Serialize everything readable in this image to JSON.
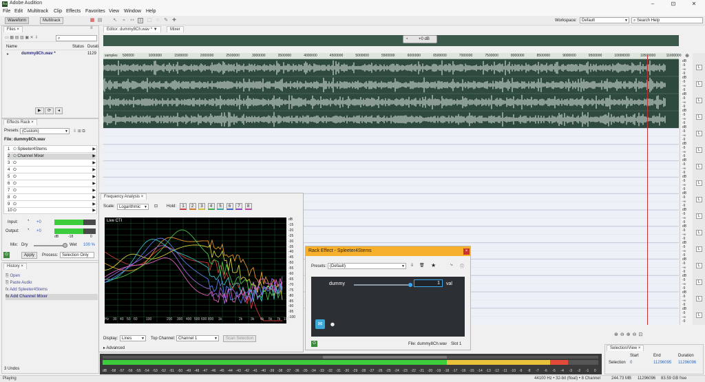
{
  "window": {
    "title": "Adobe Audition",
    "app_badge": "Au",
    "min": "–",
    "max": "⊡",
    "close": "✕"
  },
  "menu": [
    "File",
    "Edit",
    "Multitrack",
    "Clip",
    "Effects",
    "Favorites",
    "View",
    "Window",
    "Help"
  ],
  "toolbar": {
    "waveform_label": "Waveform",
    "multitrack_label": "Multitrack",
    "workspace_label": "Workspace:",
    "workspace_value": "Default",
    "search_placeholder": "Search Help"
  },
  "files_panel": {
    "title": "Files",
    "col_name": "Name",
    "col_status": "Status",
    "col_duration": "Durati",
    "file_name": "dummy8Ch.wav *",
    "file_duration": "1129"
  },
  "effects_rack": {
    "title": "Effects Rack",
    "presets_label": "Presets:",
    "presets_value": "(Custom)",
    "file_label": "File: dummy8Ch.wav",
    "slots": [
      "Spleeter4Stems",
      "Channel Mixer",
      "",
      "",
      "",
      "",
      "",
      "",
      "",
      ""
    ],
    "input_label": "Input:",
    "input_value": "+0",
    "output_label": "Output:",
    "output_value": "+0",
    "meter_marks": [
      "dB",
      "-18",
      "0"
    ],
    "mix_label": "Mix:",
    "dry_label": "Dry",
    "wet_label": "Wet",
    "wet_value": "100 %",
    "apply_label": "Apply",
    "process_label": "Process:",
    "process_value": "Selection Only"
  },
  "history": {
    "title": "History",
    "items": [
      "Open",
      "Paste Audio",
      "Add Spleeter4Stems",
      "Add Channel Mixer"
    ],
    "undo_count": "3 Undos"
  },
  "editor": {
    "tab_label": "Editor: dummy8Ch.wav *",
    "mixer_label": "Mixer",
    "volume_value": "+0 dB",
    "ruler_unit": "samples",
    "ruler_ticks": [
      "500000",
      "1000000",
      "1500000",
      "2000000",
      "2500000",
      "3000000",
      "3500000",
      "4000000",
      "4500000",
      "5000000",
      "5500000",
      "6000000",
      "6500000",
      "7000000",
      "7500000",
      "8000000",
      "8500000",
      "9000000",
      "9500000",
      "10000000",
      "10500000",
      "11000000"
    ],
    "db_label": "dB"
  },
  "freq_analysis": {
    "title": "Frequency Analysis",
    "scale_label": "Scale:",
    "scale_value": "Logarithmic",
    "hold_label": "Hold:",
    "hold_buttons": [
      "1",
      "2",
      "3",
      "4",
      "5",
      "6",
      "7",
      "8"
    ],
    "hold_colors": [
      "#d23b3b",
      "#d27a2a",
      "#d6c43a",
      "#3fae3f",
      "#2ea8a8",
      "#3a5fd2",
      "#8e44c8",
      "#c844a8"
    ],
    "live_label": "Live CTI",
    "db_ticks": [
      "dB",
      "-15",
      "-20",
      "-25",
      "-30",
      "-35",
      "-40",
      "-45",
      "-50",
      "-55",
      "-60",
      "-65",
      "-70",
      "-75",
      "-80",
      "-85",
      "-90",
      "-95",
      "-100"
    ],
    "hz_ticks": [
      "Hz",
      "30",
      "40",
      "50",
      "60",
      "100",
      "200",
      "300",
      "400",
      "500",
      "600",
      "800",
      "1k",
      "2k",
      "3k",
      "4k",
      "5k",
      "7k",
      "10k"
    ],
    "display_label": "Display:",
    "display_value": "Lines",
    "top_channel_label": "Top Channel:",
    "top_channel_value": "Channel 1",
    "scan_label": "Scan Selection",
    "advanced_label": "Advanced"
  },
  "rack_effect": {
    "title": "Rack Effect - Spleeter4Stems",
    "presets_label": "Presets:",
    "presets_value": "(Default)",
    "param_name": "dummy",
    "param_value": "1",
    "param_unit": "val",
    "file_label": "File: dummy8Ch.wav",
    "slot_label": "Slot 1",
    "slider_fraction": 1.0
  },
  "level_meter": {
    "ticks": [
      "dB",
      "-58",
      "-57",
      "-56",
      "-55",
      "-54",
      "-53",
      "-52",
      "-51",
      "-50",
      "-49",
      "-48",
      "-47",
      "-46",
      "-45",
      "-44",
      "-43",
      "-42",
      "-41",
      "-40",
      "-39",
      "-38",
      "-37",
      "-36",
      "-35",
      "-34",
      "-33",
      "-32",
      "-31",
      "-30",
      "-29",
      "-28",
      "-27",
      "-26",
      "-25",
      "-24",
      "-23",
      "-22",
      "-21",
      "-20",
      "-19",
      "-18",
      "-17",
      "-16",
      "-15",
      "-14",
      "-13",
      "-12",
      "-11",
      "-10",
      "-9",
      "-8",
      "-7",
      "-6",
      "-5",
      "-4",
      "-3",
      "-2",
      "-1",
      "0"
    ]
  },
  "selection_view": {
    "title": "Selection/View",
    "col_start": "Start",
    "col_end": "End",
    "col_duration": "Duration",
    "row_label": "Selection",
    "start": "0",
    "end": "11296095",
    "duration": "11296096"
  },
  "status": {
    "state": "Playing",
    "format": "44100 Hz • 32-bit (float) • 8 Channel",
    "size": "244.73 MB",
    "samples": "11296096",
    "free": "83.59 GB free"
  },
  "colors": {
    "accent": "#f7b02c",
    "waveform": "#e8f0ec",
    "wave_bg": "#2e4a3e",
    "meter_green": "#3ccc3c"
  },
  "freq_series_colors": [
    "#d23b3b",
    "#e8962e",
    "#d8d23a",
    "#4ac04a",
    "#38c0c0",
    "#5a7ae8",
    "#a060e0",
    "#e060c0"
  ]
}
